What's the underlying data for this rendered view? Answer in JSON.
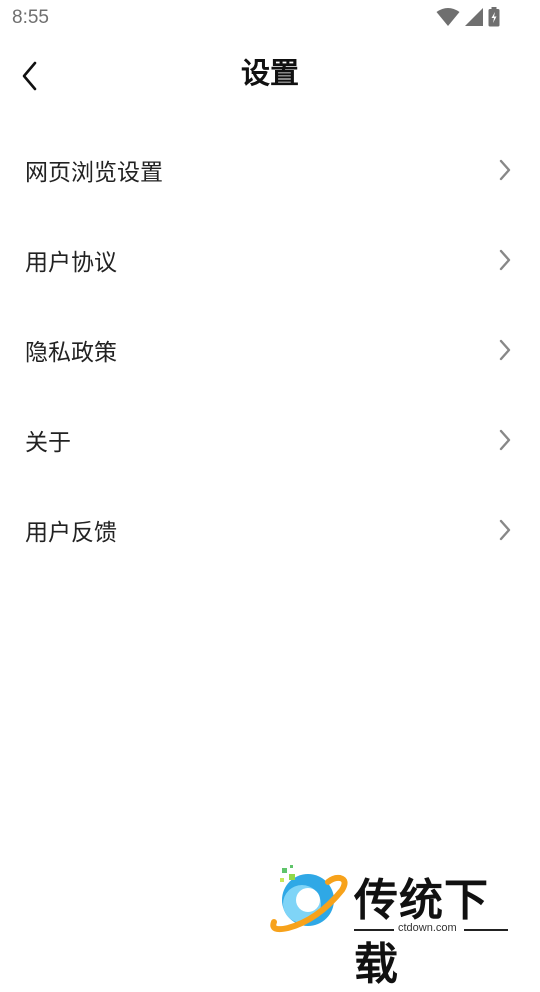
{
  "status_bar": {
    "time": "8:55",
    "icons": [
      "wifi-icon",
      "signal-icon",
      "battery-charging-icon"
    ]
  },
  "header": {
    "title": "设置",
    "back_icon": "chevron-left-icon"
  },
  "settings": {
    "items": [
      {
        "label": "网页浏览设置",
        "icon": "chevron-right-icon"
      },
      {
        "label": "用户协议",
        "icon": "chevron-right-icon"
      },
      {
        "label": "隐私政策",
        "icon": "chevron-right-icon"
      },
      {
        "label": "关于",
        "icon": "chevron-right-icon"
      },
      {
        "label": "用户反馈",
        "icon": "chevron-right-icon"
      }
    ]
  },
  "watermark": {
    "brand": "传统下载",
    "url": "ctdown.com"
  },
  "colors": {
    "background": "#ffffff",
    "text": "#222222",
    "chevron": "#888888",
    "status_text": "#6f6f6f"
  }
}
